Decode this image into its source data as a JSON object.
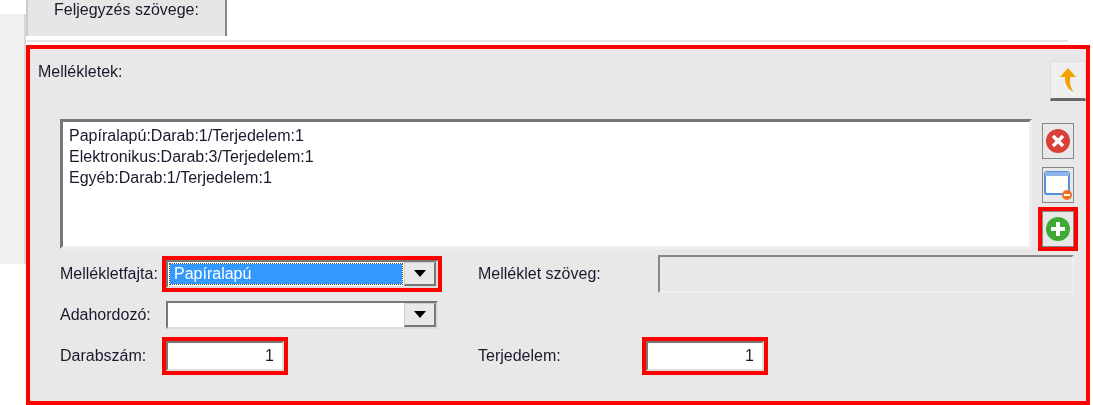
{
  "tab": {
    "label": "Feljegyzés szövege:"
  },
  "attachments": {
    "title": "Mellékletek:",
    "highlighted": true,
    "items": [
      "Papíralapú:Darab:1/Terjedelem:1",
      "Elektronikus:Darab:3/Terjedelem:1",
      "Egyéb:Darab:1/Terjedelem:1"
    ],
    "side_buttons": [
      {
        "kind": "delete",
        "highlighted": false
      },
      {
        "kind": "remove-window",
        "highlighted": false
      },
      {
        "kind": "add",
        "highlighted": true
      }
    ],
    "type": {
      "label": "Mellékletfajta:",
      "value": "Papíralapú",
      "focused": true,
      "highlighted": true
    },
    "text": {
      "label": "Melléklet szöveg:",
      "disabled": true
    },
    "medium": {
      "label": "Adahordozó:",
      "highlighted": false
    },
    "count": {
      "label": "Darabszám:",
      "value": "1",
      "highlighted": true
    },
    "extent": {
      "label": "Terjedelem:",
      "value": "1",
      "highlighted": true
    }
  }
}
